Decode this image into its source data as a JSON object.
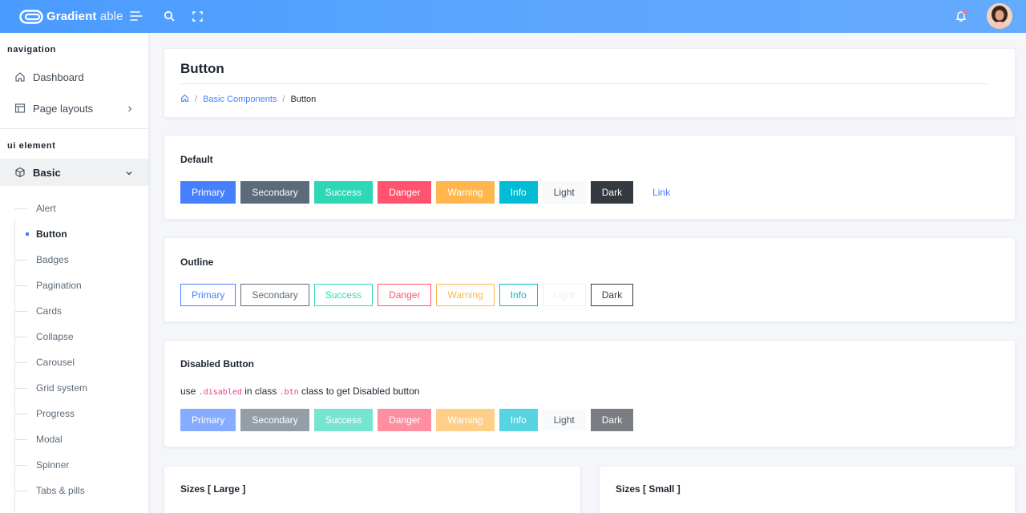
{
  "brand": {
    "name_bold": "Gradient",
    "name_light": "able"
  },
  "header": {
    "icons": [
      "menu-icon",
      "search-icon",
      "fullscreen-icon",
      "bell-icon"
    ],
    "avatar": "avatar"
  },
  "sidebar": {
    "caption_nav": "navigation",
    "dashboard": "Dashboard",
    "page_layouts": "Page layouts",
    "caption_ui": "ui element",
    "basic": "Basic",
    "sub_items": [
      "Alert",
      "Button",
      "Badges",
      "Pagination",
      "Cards",
      "Collapse",
      "Carousel",
      "Grid system",
      "Progress",
      "Modal",
      "Spinner",
      "Tabs & pills"
    ],
    "active_sub": "Button"
  },
  "page": {
    "title": "Button",
    "breadcrumb": {
      "parent": "Basic Components",
      "current": "Button"
    }
  },
  "default_card": {
    "title": "Default",
    "buttons": [
      "Primary",
      "Secondary",
      "Success",
      "Danger",
      "Warning",
      "Info",
      "Light",
      "Dark",
      "Link"
    ]
  },
  "outline_card": {
    "title": "Outline",
    "buttons": [
      "Primary",
      "Secondary",
      "Success",
      "Danger",
      "Warning",
      "Info",
      "Light",
      "Dark"
    ]
  },
  "disabled_card": {
    "title": "Disabled Button",
    "desc_use": "use",
    "desc_code1": ".disabled",
    "desc_mid": "in class",
    "desc_code2": ".btn",
    "desc_end": "class to get Disabled button",
    "buttons": [
      "Primary",
      "Secondary",
      "Success",
      "Danger",
      "Warning",
      "Info",
      "Light",
      "Dark"
    ]
  },
  "sizes_large": {
    "title": "Sizes [ Large ]"
  },
  "sizes_small": {
    "title": "Sizes [ Small ]"
  },
  "colors": {
    "primary": "#4680ff",
    "secondary": "#5b6b79",
    "success": "#2ed8b6",
    "danger": "#ff5370",
    "warning": "#ffb64d",
    "info": "#00bcd4",
    "light": "#f8f9fa",
    "dark": "#343a40"
  }
}
